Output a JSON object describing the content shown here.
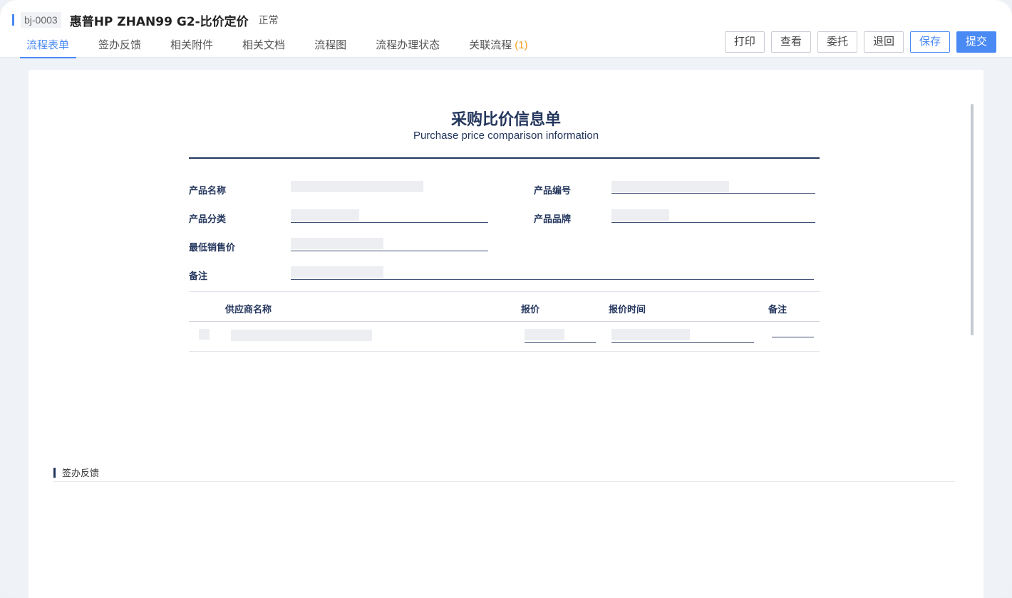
{
  "header": {
    "doc_id": "bj-0003",
    "title": "惠普HP ZHAN99 G2-比价定价",
    "status": "正常"
  },
  "tabs": [
    {
      "label": "流程表单",
      "active": true
    },
    {
      "label": "签办反馈"
    },
    {
      "label": "相关附件"
    },
    {
      "label": "相关文档"
    },
    {
      "label": "流程图"
    },
    {
      "label": "流程办理状态"
    },
    {
      "label": "关联流程",
      "count": "(1)"
    }
  ],
  "toolbar": {
    "print": "打印",
    "view": "查看",
    "delegate": "委托",
    "return": "退回",
    "save": "保存",
    "submit": "提交"
  },
  "form": {
    "title": "采购比价信息单",
    "subtitle": "Purchase price comparison information",
    "fields": {
      "product_name": "产品名称",
      "product_code": "产品编号",
      "product_category": "产品分类",
      "product_brand": "产品品牌",
      "min_price": "最低销售价",
      "remark": "备注"
    },
    "table_headers": {
      "supplier": "供应商名称",
      "quote": "报价",
      "quote_time": "报价时间",
      "remark": "备注"
    }
  },
  "feedback_section": {
    "label": "签办反馈"
  },
  "colors": {
    "accent": "#4a8af4",
    "navy": "#24365d",
    "count": "#f0a020"
  }
}
